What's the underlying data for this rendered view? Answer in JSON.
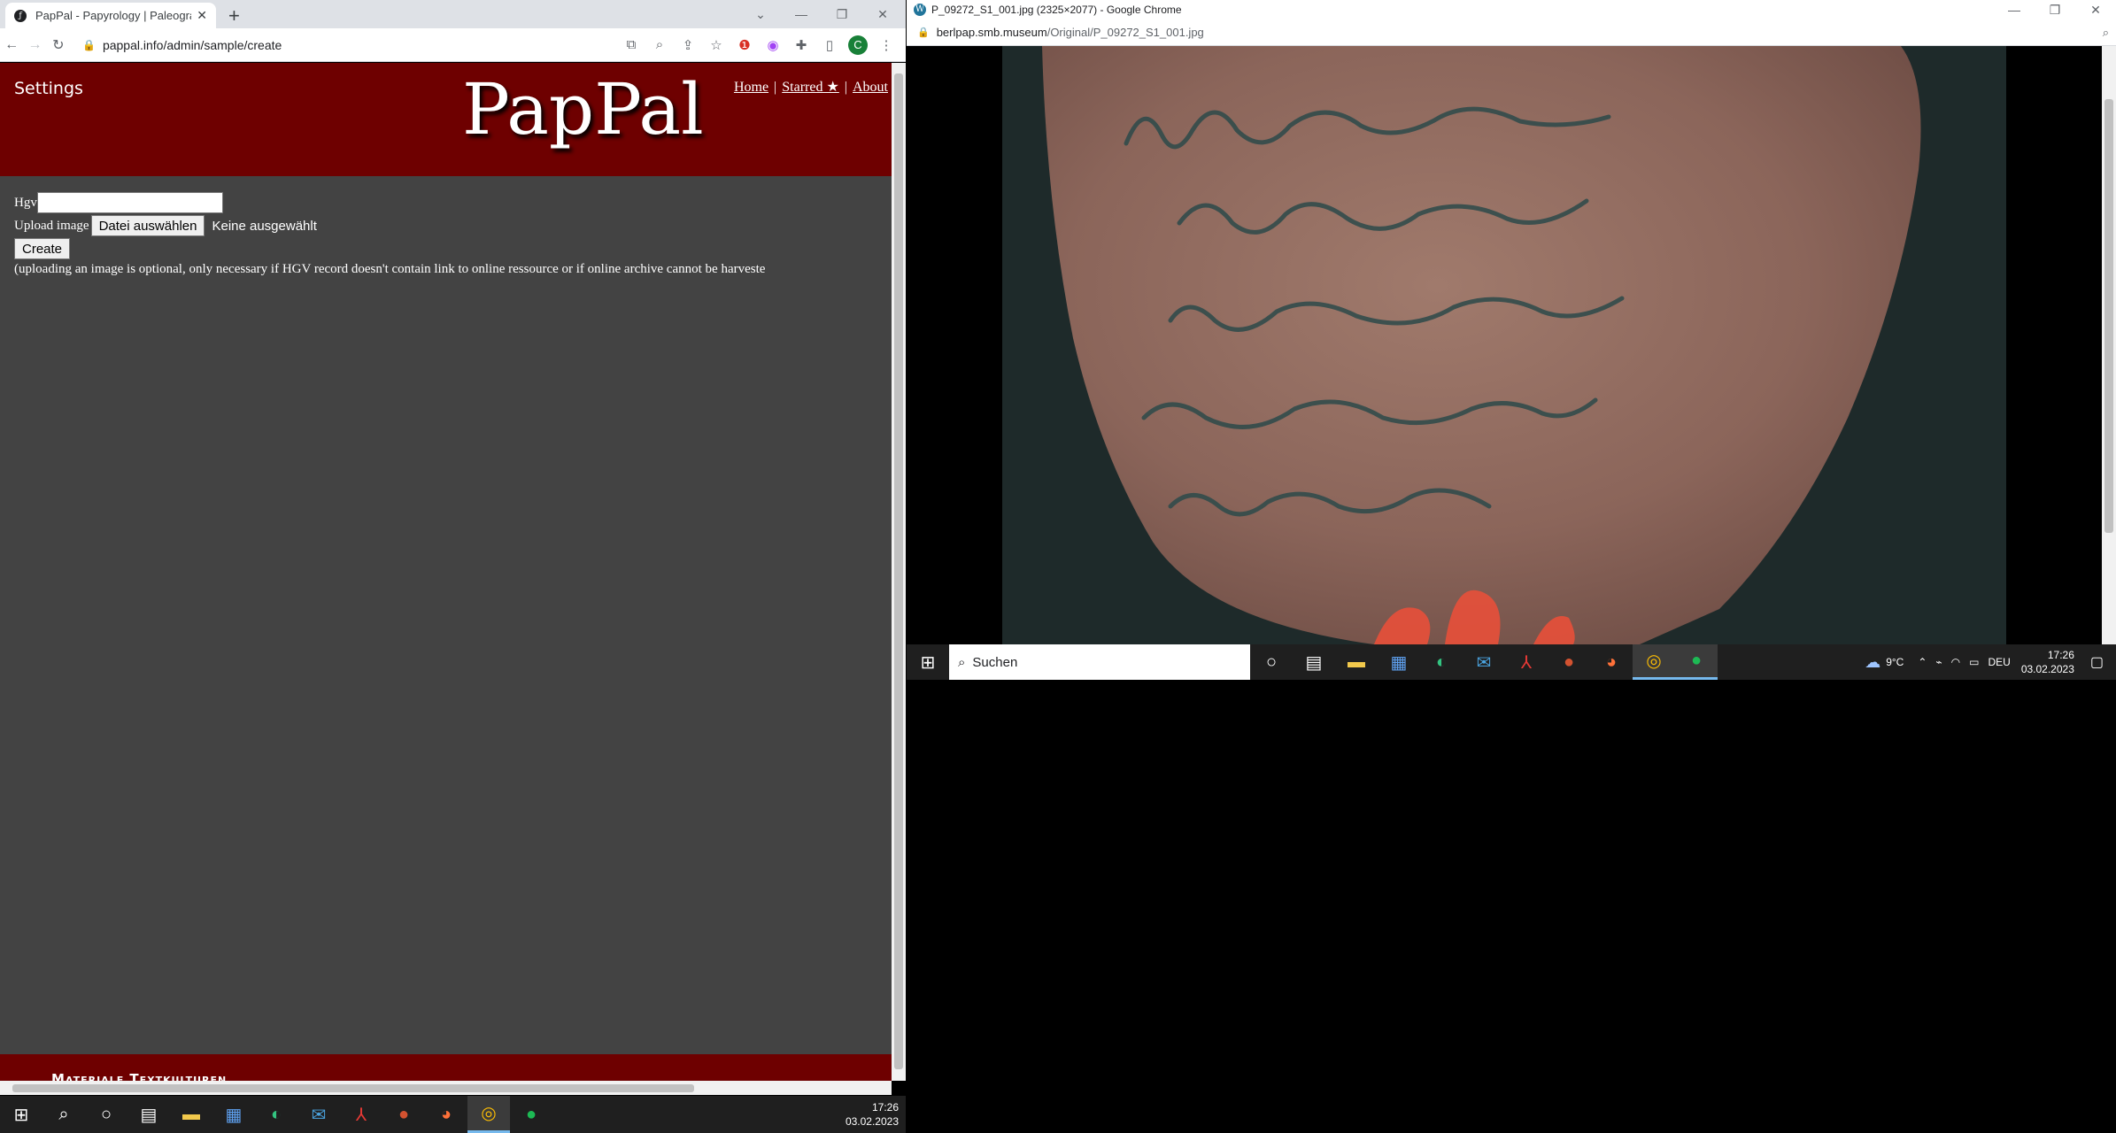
{
  "left_window": {
    "tab_title": "PapPal - Papyrology | Paleograph",
    "url": "pappal.info/admin/sample/create",
    "site": {
      "settings_label": "Settings",
      "logo_text": "PapPal",
      "nav": {
        "home": "Home",
        "starred": "Starred ★",
        "about": "About",
        "separator": "|"
      }
    },
    "form": {
      "hgv_label": "Hgv",
      "hgv_value": "",
      "upload_label": "Upload image",
      "file_button_label": "Datei auswählen",
      "file_status": "Keine ausgewählt",
      "create_label": "Create",
      "note": "(uploading an image is optional, only necessary if HGV record doesn't contain link to online ressource or if online archive cannot be harveste"
    },
    "footer_text": "Materiale Textkulturen",
    "profile_initial": "C"
  },
  "right_window": {
    "title": "P_09272_S1_001.jpg (2325×2077) - Google Chrome",
    "url_host": "berlpap.smb.museum",
    "url_path": "/Original/P_09272_S1_001.jpg"
  },
  "taskbar_left": {
    "time": "17:26",
    "date": "03.02.2023"
  },
  "taskbar_right": {
    "search_placeholder": "Suchen",
    "weather": "9°C",
    "language": "DEU",
    "time": "17:26",
    "date": "03.02.2023"
  },
  "colors": {
    "site_header": "#6e0000",
    "page_bg": "#434343",
    "taskbar": "#1f1f1f"
  }
}
